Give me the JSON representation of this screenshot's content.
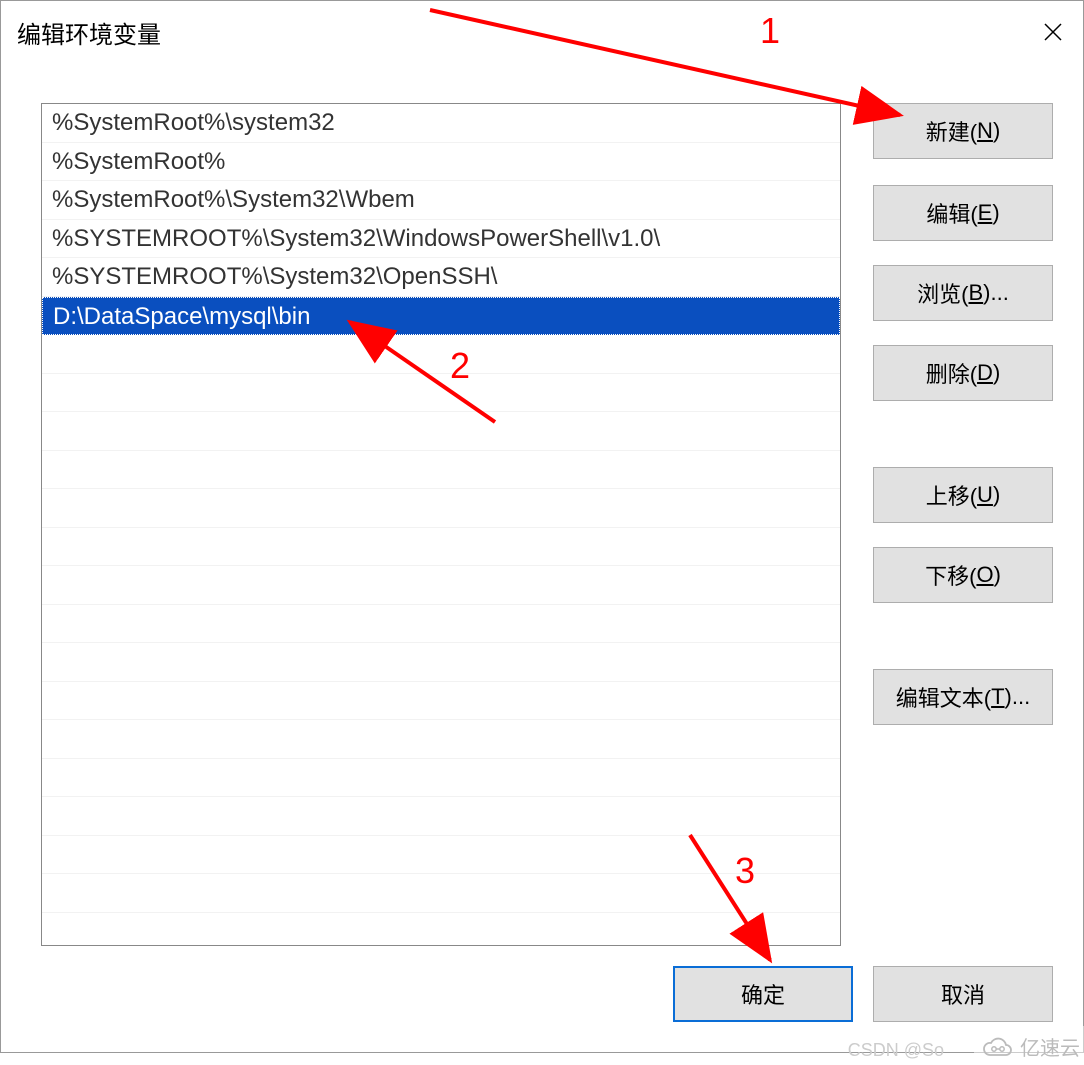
{
  "dialog": {
    "title": "编辑环境变量"
  },
  "list": {
    "items": [
      {
        "text": "%SystemRoot%\\system32",
        "selected": false
      },
      {
        "text": "%SystemRoot%",
        "selected": false
      },
      {
        "text": "%SystemRoot%\\System32\\Wbem",
        "selected": false
      },
      {
        "text": "%SYSTEMROOT%\\System32\\WindowsPowerShell\\v1.0\\",
        "selected": false
      },
      {
        "text": "%SYSTEMROOT%\\System32\\OpenSSH\\",
        "selected": false
      },
      {
        "text": "D:\\DataSpace\\mysql\\bin",
        "selected": true
      }
    ]
  },
  "buttons": {
    "new_label": "新建(",
    "new_key": "N",
    "new_suffix": ")",
    "edit_label": "编辑(",
    "edit_key": "E",
    "edit_suffix": ")",
    "browse_label": "浏览(",
    "browse_key": "B",
    "browse_suffix": ")...",
    "delete_label": "删除(",
    "delete_key": "D",
    "delete_suffix": ")",
    "moveup_label": "上移(",
    "moveup_key": "U",
    "moveup_suffix": ")",
    "movedown_label": "下移(",
    "movedown_key": "O",
    "movedown_suffix": ")",
    "edittext_label": "编辑文本(",
    "edittext_key": "T",
    "edittext_suffix": ")...",
    "ok": "确定",
    "cancel": "取消"
  },
  "annotations": {
    "label1": "1",
    "label2": "2",
    "label3": "3"
  },
  "watermark": {
    "csdn": "CSDN @So",
    "logo_text": "亿速云"
  }
}
